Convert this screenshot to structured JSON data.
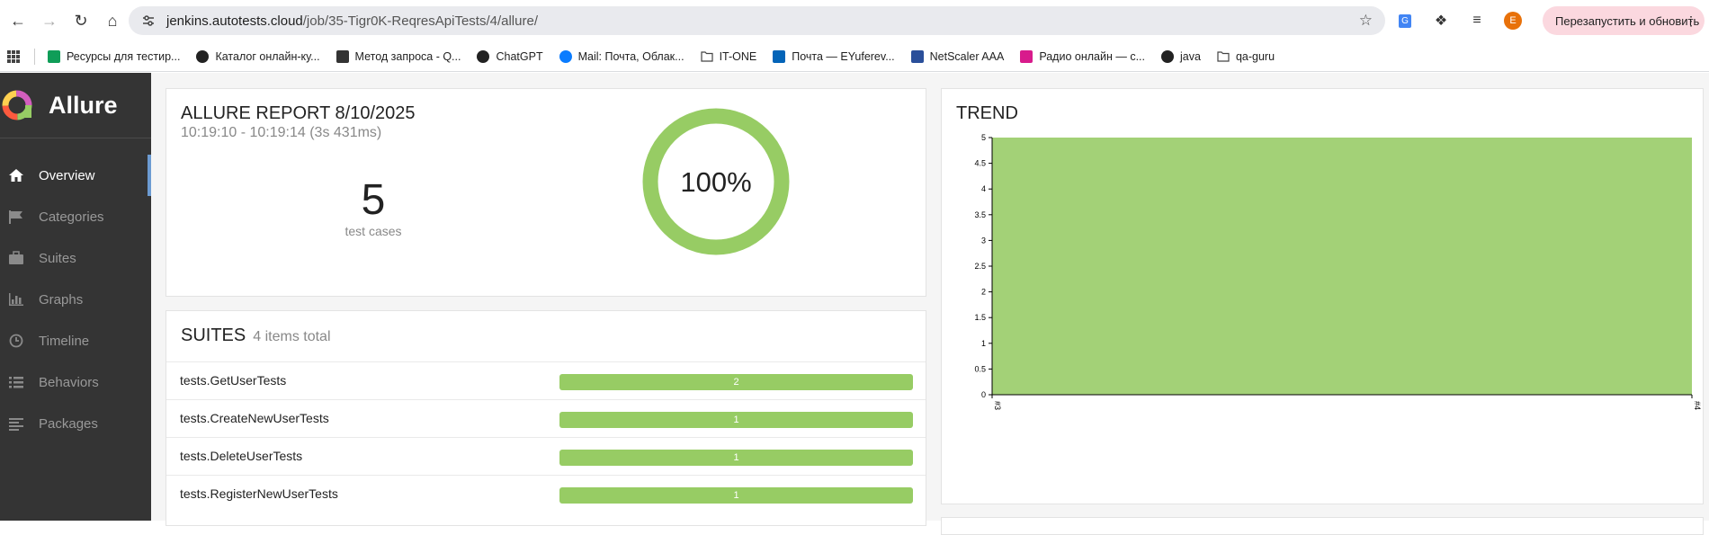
{
  "browser": {
    "url_host": "jenkins.autotests.cloud",
    "url_path": "/job/35-Tigr0K-ReqresApiTests/4/allure/",
    "profile_initial": "E",
    "relaunch_label": "Перезапустить и обновить",
    "bookmarks": [
      {
        "label": "Ресурсы для тестир...",
        "icon": "sheets-icon",
        "color": "#0f9d58"
      },
      {
        "label": "Каталог онлайн-ку...",
        "icon": "circle-logo-icon",
        "color": "#222222"
      },
      {
        "label": "Метод запроса - Q...",
        "icon": "code-icon",
        "color": "#333333"
      },
      {
        "label": "ChatGPT",
        "icon": "chatgpt-icon",
        "color": "#222222"
      },
      {
        "label": "Mail: Почта, Облак...",
        "icon": "mail-at-icon",
        "color": "#0a7cff"
      },
      {
        "label": "IT-ONE",
        "icon": "folder-icon",
        "color": "#444444"
      },
      {
        "label": "Почта — EYuferev...",
        "icon": "outlook-icon",
        "color": "#0364b8"
      },
      {
        "label": "NetScaler AAA",
        "icon": "netscaler-icon",
        "color": "#2a4f9a"
      },
      {
        "label": "Радио онлайн — с...",
        "icon": "play-icon",
        "color": "#d81b8c"
      },
      {
        "label": "java",
        "icon": "github-icon",
        "color": "#222222"
      },
      {
        "label": "qa-guru",
        "icon": "folder-icon",
        "color": "#444444"
      }
    ]
  },
  "sidebar": {
    "brand": "Allure",
    "items": [
      {
        "label": "Overview",
        "icon": "home-icon",
        "active": true
      },
      {
        "label": "Categories",
        "icon": "flag-icon",
        "active": false
      },
      {
        "label": "Suites",
        "icon": "briefcase-icon",
        "active": false
      },
      {
        "label": "Graphs",
        "icon": "bar-chart-icon",
        "active": false
      },
      {
        "label": "Timeline",
        "icon": "clock-icon",
        "active": false
      },
      {
        "label": "Behaviors",
        "icon": "list-icon",
        "active": false
      },
      {
        "label": "Packages",
        "icon": "align-left-icon",
        "active": false
      }
    ]
  },
  "summary": {
    "title": "ALLURE REPORT 8/10/2025",
    "time": "10:19:10 - 10:19:14 (3s 431ms)",
    "count": "5",
    "count_label": "test cases",
    "percent_label": "100%",
    "pass_fraction": 1.0,
    "pass_color": "#97cc64"
  },
  "suites": {
    "title": "SUITES",
    "count_text": "4 items total",
    "rows": [
      {
        "name": "tests.GetUserTests",
        "passed": "2"
      },
      {
        "name": "tests.CreateNewUserTests",
        "passed": "1"
      },
      {
        "name": "tests.DeleteUserTests",
        "passed": "1"
      },
      {
        "name": "tests.RegisterNewUserTests",
        "passed": "1"
      }
    ]
  },
  "trend": {
    "title": "TREND"
  },
  "chart_data": {
    "type": "area",
    "x": [
      "#3",
      "#4"
    ],
    "series": [
      {
        "values": [
          5,
          5
        ],
        "color": "#a3d177"
      }
    ],
    "yticks": [
      "0",
      "0.5",
      "1",
      "1.5",
      "2",
      "2.5",
      "3",
      "3.5",
      "4",
      "4.5",
      "5"
    ],
    "ylim": [
      0,
      5
    ],
    "xlabel": "",
    "ylabel": ""
  }
}
